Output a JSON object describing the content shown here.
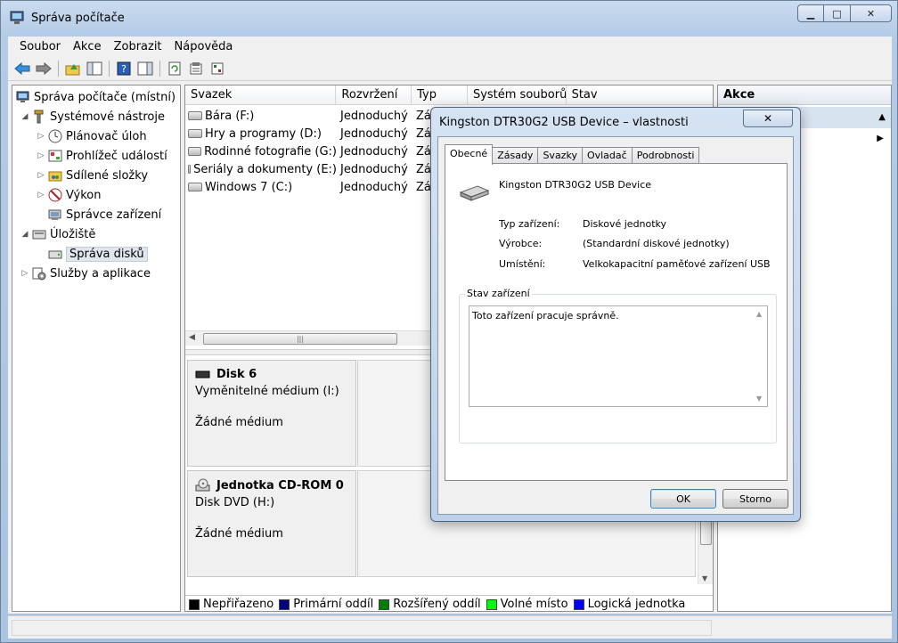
{
  "window": {
    "title": "Správa počítače",
    "minimize": "▁",
    "maximize": "□",
    "close": "✕"
  },
  "menu": [
    "Soubor",
    "Akce",
    "Zobrazit",
    "Nápověda"
  ],
  "tree": {
    "root": "Správa počítače (místní)",
    "system_tools": "Systémové nástroje",
    "task_scheduler": "Plánovač úloh",
    "event_viewer": "Prohlížeč událostí",
    "shared_folders": "Sdílené složky",
    "performance": "Výkon",
    "device_manager": "Správce zařízení",
    "storage": "Úložiště",
    "disk_management": "Správa disků",
    "services": "Služby a aplikace"
  },
  "volumes": {
    "headers": [
      "Svazek",
      "Rozvržení",
      "Typ",
      "Systém souborů",
      "Stav"
    ],
    "rows": [
      {
        "name": "Bára (F:)",
        "layout": "Jednoduchý",
        "type": "Zá"
      },
      {
        "name": "Hry a programy (D:)",
        "layout": "Jednoduchý",
        "type": "Zá"
      },
      {
        "name": "Rodinné fotografie (G:)",
        "layout": "Jednoduchý",
        "type": "Zá"
      },
      {
        "name": "Seriály a dokumenty (E:)",
        "layout": "Jednoduchý",
        "type": "Zá"
      },
      {
        "name": "Windows 7 (C:)",
        "layout": "Jednoduchý",
        "type": "Zá"
      }
    ]
  },
  "disks": [
    {
      "title": "Disk 6",
      "line": "Vyměnitelné médium (I:)",
      "medium": "Žádné médium"
    },
    {
      "title": "Jednotka CD-ROM 0",
      "line": "Disk DVD (H:)",
      "medium": "Žádné médium"
    }
  ],
  "legend": [
    {
      "label": "Nepřiřazeno",
      "color": "#000000"
    },
    {
      "label": "Primární oddíl",
      "color": "#00007f"
    },
    {
      "label": "Rozšířený oddíl",
      "color": "#007f00"
    },
    {
      "label": "Volné místo",
      "color": "#00ff00"
    },
    {
      "label": "Logická jednotka",
      "color": "#0000ff"
    }
  ],
  "actions": {
    "title": "Akce"
  },
  "dialog": {
    "title": "Kingston DTR30G2 USB Device – vlastnosti",
    "close": "✕",
    "tabs": [
      "Obecné",
      "Zásady",
      "Svazky",
      "Ovladač",
      "Podrobnosti"
    ],
    "device_name": "Kingston DTR30G2 USB Device",
    "props": [
      {
        "label": "Typ zařízení:",
        "value": "Diskové jednotky"
      },
      {
        "label": "Výrobce:",
        "value": "(Standardní diskové jednotky)"
      },
      {
        "label": "Umístění:",
        "value": "Velkokapacitní paměťové zařízení USB"
      }
    ],
    "status_label": "Stav zařízení",
    "status_text": "Toto zařízení pracuje správně.",
    "ok": "OK",
    "cancel": "Storno"
  }
}
